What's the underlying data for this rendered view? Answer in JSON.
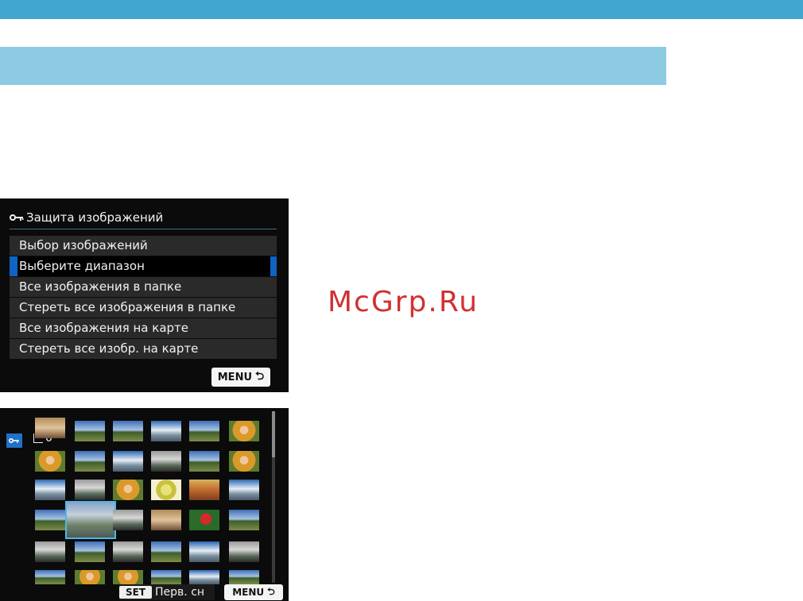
{
  "menu_screen": {
    "title": "Защита изображений",
    "items": [
      {
        "label": "Выбор изображений",
        "selected": false
      },
      {
        "label": "Выберите диапазон",
        "selected": true
      },
      {
        "label": "Все изображения в папке",
        "selected": false
      },
      {
        "label": "Стереть все изображения в папке",
        "selected": false
      },
      {
        "label": "Все изображения на карте",
        "selected": false
      },
      {
        "label": "Стереть все изобр. на карте",
        "selected": false
      }
    ],
    "back_label": "MENU"
  },
  "thumb_screen": {
    "protected_count": "0",
    "set_key": "SET",
    "set_label": "Перв. сн",
    "back_label": "MENU"
  },
  "watermark": "McGrp.Ru",
  "colors": {
    "top_bar": "#41a6cf",
    "section_bar": "#8ccbe2",
    "selection": "#0f63c4",
    "thumb_frame": "#4fb6e6",
    "watermark": "#d23030"
  }
}
